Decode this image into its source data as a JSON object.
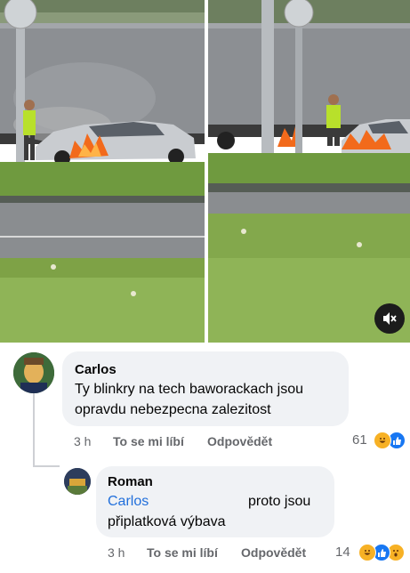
{
  "media": {
    "left_photo": "burning-car-photo-left",
    "right_photo": "burning-car-photo-right",
    "mute_icon": "speaker-muted-icon"
  },
  "comments": [
    {
      "author": "Carlos",
      "text_line1": "Ty blinkry na tech baworackach jsou",
      "text_line2": "opravdu nebezpecna zalezitost",
      "time": "3 h",
      "like": "To se mi líbí",
      "reply": "Odpovědět",
      "reaction_count": "61",
      "reactions": [
        "haha",
        "like"
      ]
    },
    {
      "author": "Roman",
      "mention": "Carlos",
      "text_line1_rest": "proto jsou",
      "text_line2": "připlatková výbava",
      "time": "3 h",
      "like": "To se mi líbí",
      "reply": "Odpovědět",
      "reaction_count": "14",
      "reactions": [
        "haha",
        "like",
        "wow"
      ]
    }
  ],
  "colors": {
    "bubble": "#f0f2f5",
    "meta": "#65676b",
    "mention": "#216fdb",
    "like_blue": "#1877f2",
    "haha_yellow": "#f7b125"
  }
}
